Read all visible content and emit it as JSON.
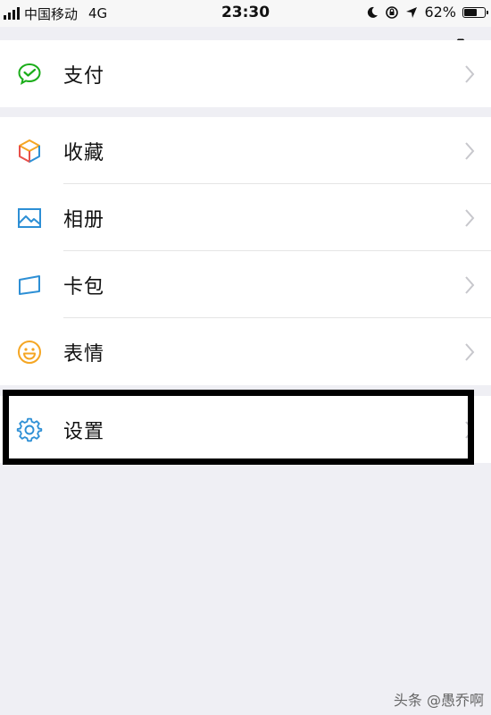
{
  "status_bar": {
    "carrier": "中国移动",
    "network": "4G",
    "time": "23:30",
    "battery_percent": "62%",
    "battery_level": 0.62
  },
  "menu": {
    "group1": [
      {
        "label": "支付",
        "icon": "wechat-pay-icon"
      }
    ],
    "group2": [
      {
        "label": "收藏",
        "icon": "cube-icon"
      },
      {
        "label": "相册",
        "icon": "photo-icon"
      },
      {
        "label": "卡包",
        "icon": "card-icon"
      },
      {
        "label": "表情",
        "icon": "smiley-icon"
      }
    ],
    "group3": [
      {
        "label": "设置",
        "icon": "gear-icon"
      }
    ]
  },
  "colors": {
    "background": "#efeff4",
    "pay_green": "#1aad19",
    "blue": "#2d8fd5",
    "orange": "#f5a623"
  },
  "watermark": "头条 @愚乔啊"
}
